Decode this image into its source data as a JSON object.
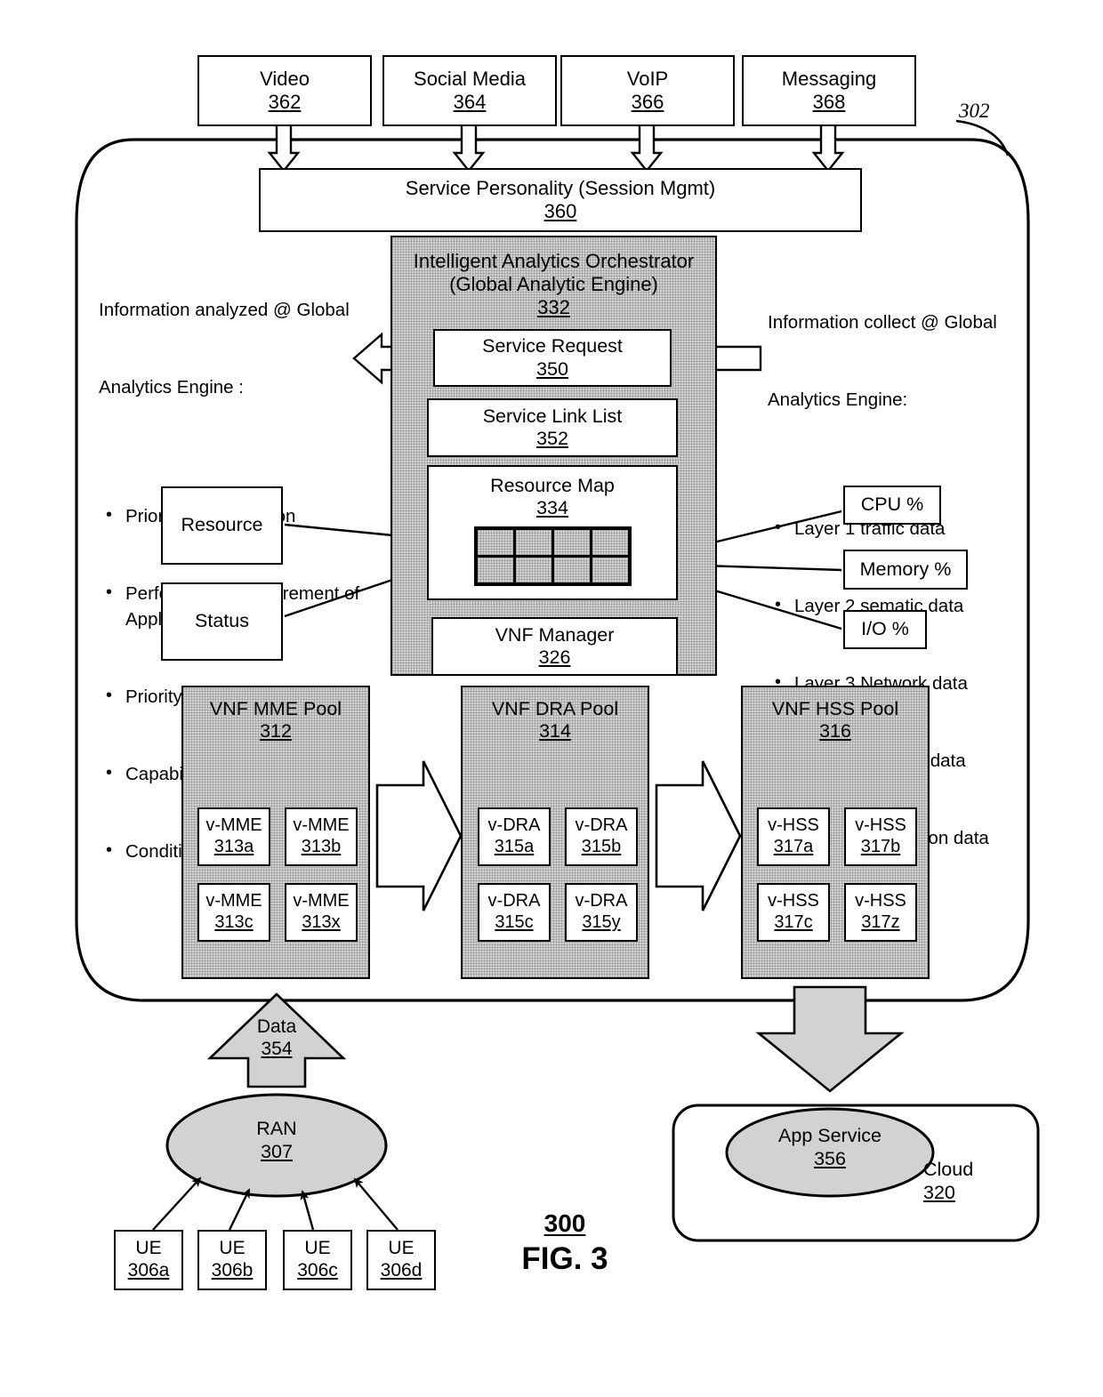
{
  "figure": {
    "number_label": "300",
    "caption": "FIG. 3",
    "system_ref": "302"
  },
  "app_boxes": [
    {
      "label": "Video",
      "num": "362"
    },
    {
      "label": "Social Media",
      "num": "364"
    },
    {
      "label": "VoIP",
      "num": "366"
    },
    {
      "label": "Messaging",
      "num": "368"
    }
  ],
  "service_personality": {
    "label": "Service Personality (Session Mgmt)",
    "num": "360"
  },
  "orchestrator": {
    "title_line1": "Intelligent Analytics Orchestrator",
    "title_line2": "(Global Analytic Engine)",
    "num": "332",
    "blocks": [
      {
        "label": "Service Request",
        "num": "350"
      },
      {
        "label": "Service Link List",
        "num": "352"
      },
      {
        "label": "Resource Map",
        "num": "334"
      },
      {
        "label": "VNF Manager",
        "num": "326"
      }
    ],
    "resource_map_grid": {
      "cols": 4,
      "rows": 2
    }
  },
  "analyzed_panel": {
    "heading_line1": "Information analyzed @ Global",
    "heading_line2": "Analytics Engine :",
    "items": [
      "Priority of Application",
      "Performance Requirement of Application",
      "Priority of user",
      "Capability of UE",
      "Condition of Network"
    ]
  },
  "collected_panel": {
    "heading_line1": "Information collect @ Global",
    "heading_line2": "Analytics Engine:",
    "items": [
      "Layer 1 traffic data",
      "Layer 2 sematic data",
      "Layer 3 Network data",
      "Layer 5 Session data",
      "Layer 7 Application data"
    ]
  },
  "left_inputs": [
    {
      "label": "Resource"
    },
    {
      "label": "Status"
    }
  ],
  "right_metrics": [
    {
      "label": "CPU %"
    },
    {
      "label": "Memory %"
    },
    {
      "label": "I/O %"
    }
  ],
  "pools": [
    {
      "title": "VNF MME Pool",
      "num": "312",
      "nodes": [
        {
          "label": "v-MME",
          "num": "313a"
        },
        {
          "label": "v-MME",
          "num": "313b"
        },
        {
          "label": "v-MME",
          "num": "313c"
        },
        {
          "label": "v-MME",
          "num": "313x"
        }
      ]
    },
    {
      "title": "VNF DRA Pool",
      "num": "314",
      "nodes": [
        {
          "label": "v-DRA",
          "num": "315a"
        },
        {
          "label": "v-DRA",
          "num": "315b"
        },
        {
          "label": "v-DRA",
          "num": "315c"
        },
        {
          "label": "v-DRA",
          "num": "315y"
        }
      ]
    },
    {
      "title": "VNF HSS Pool",
      "num": "316",
      "nodes": [
        {
          "label": "v-HSS",
          "num": "317a"
        },
        {
          "label": "v-HSS",
          "num": "317b"
        },
        {
          "label": "v-HSS",
          "num": "317c"
        },
        {
          "label": "v-HSS",
          "num": "317z"
        }
      ]
    }
  ],
  "data_arrow": {
    "label": "Data",
    "num": "354"
  },
  "ran": {
    "label": "RAN",
    "num": "307"
  },
  "ue_boxes": [
    {
      "label": "UE",
      "num": "306a"
    },
    {
      "label": "UE",
      "num": "306b"
    },
    {
      "label": "UE",
      "num": "306c"
    },
    {
      "label": "UE",
      "num": "306d"
    }
  ],
  "cloud": {
    "label": "Cloud",
    "num": "320",
    "app_service": {
      "label": "App Service",
      "num": "356"
    }
  },
  "colors": {
    "stroke": "#000000",
    "shade": "#d2d2d2",
    "background": "#ffffff"
  }
}
